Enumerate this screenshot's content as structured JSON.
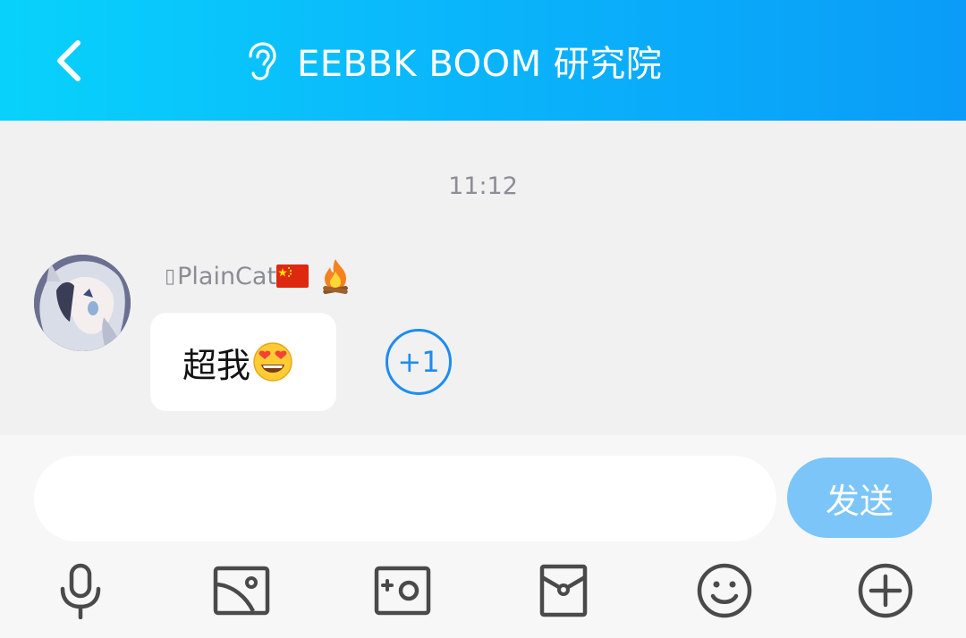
{
  "header": {
    "back_icon": "chevron-left-icon",
    "title_icon": "ear-icon",
    "title": "EEBBK BOOM 研究院"
  },
  "chat": {
    "timestamp": "11:12",
    "message": {
      "avatar": "anime-girl-avatar",
      "sender_mark": "▯",
      "sender_name": "PlainCat",
      "sender_badges": [
        "china-flag-icon",
        "fire-icon"
      ],
      "text": "超我",
      "emoji": "star-struck-face-icon",
      "reaction_label": "+1"
    }
  },
  "input": {
    "placeholder": "",
    "value": "",
    "send_label": "发送"
  },
  "toolbar": {
    "icons": [
      "microphone-icon",
      "image-icon",
      "camera-icon",
      "red-packet-icon",
      "smiley-icon",
      "add-circle-icon"
    ]
  },
  "colors": {
    "header_start": "#08d2fb",
    "header_end": "#0a9cf8",
    "send_button": "#7cc5f8",
    "reaction_blue": "#1d8df1",
    "toolbar_icon": "#4a4a4a"
  }
}
